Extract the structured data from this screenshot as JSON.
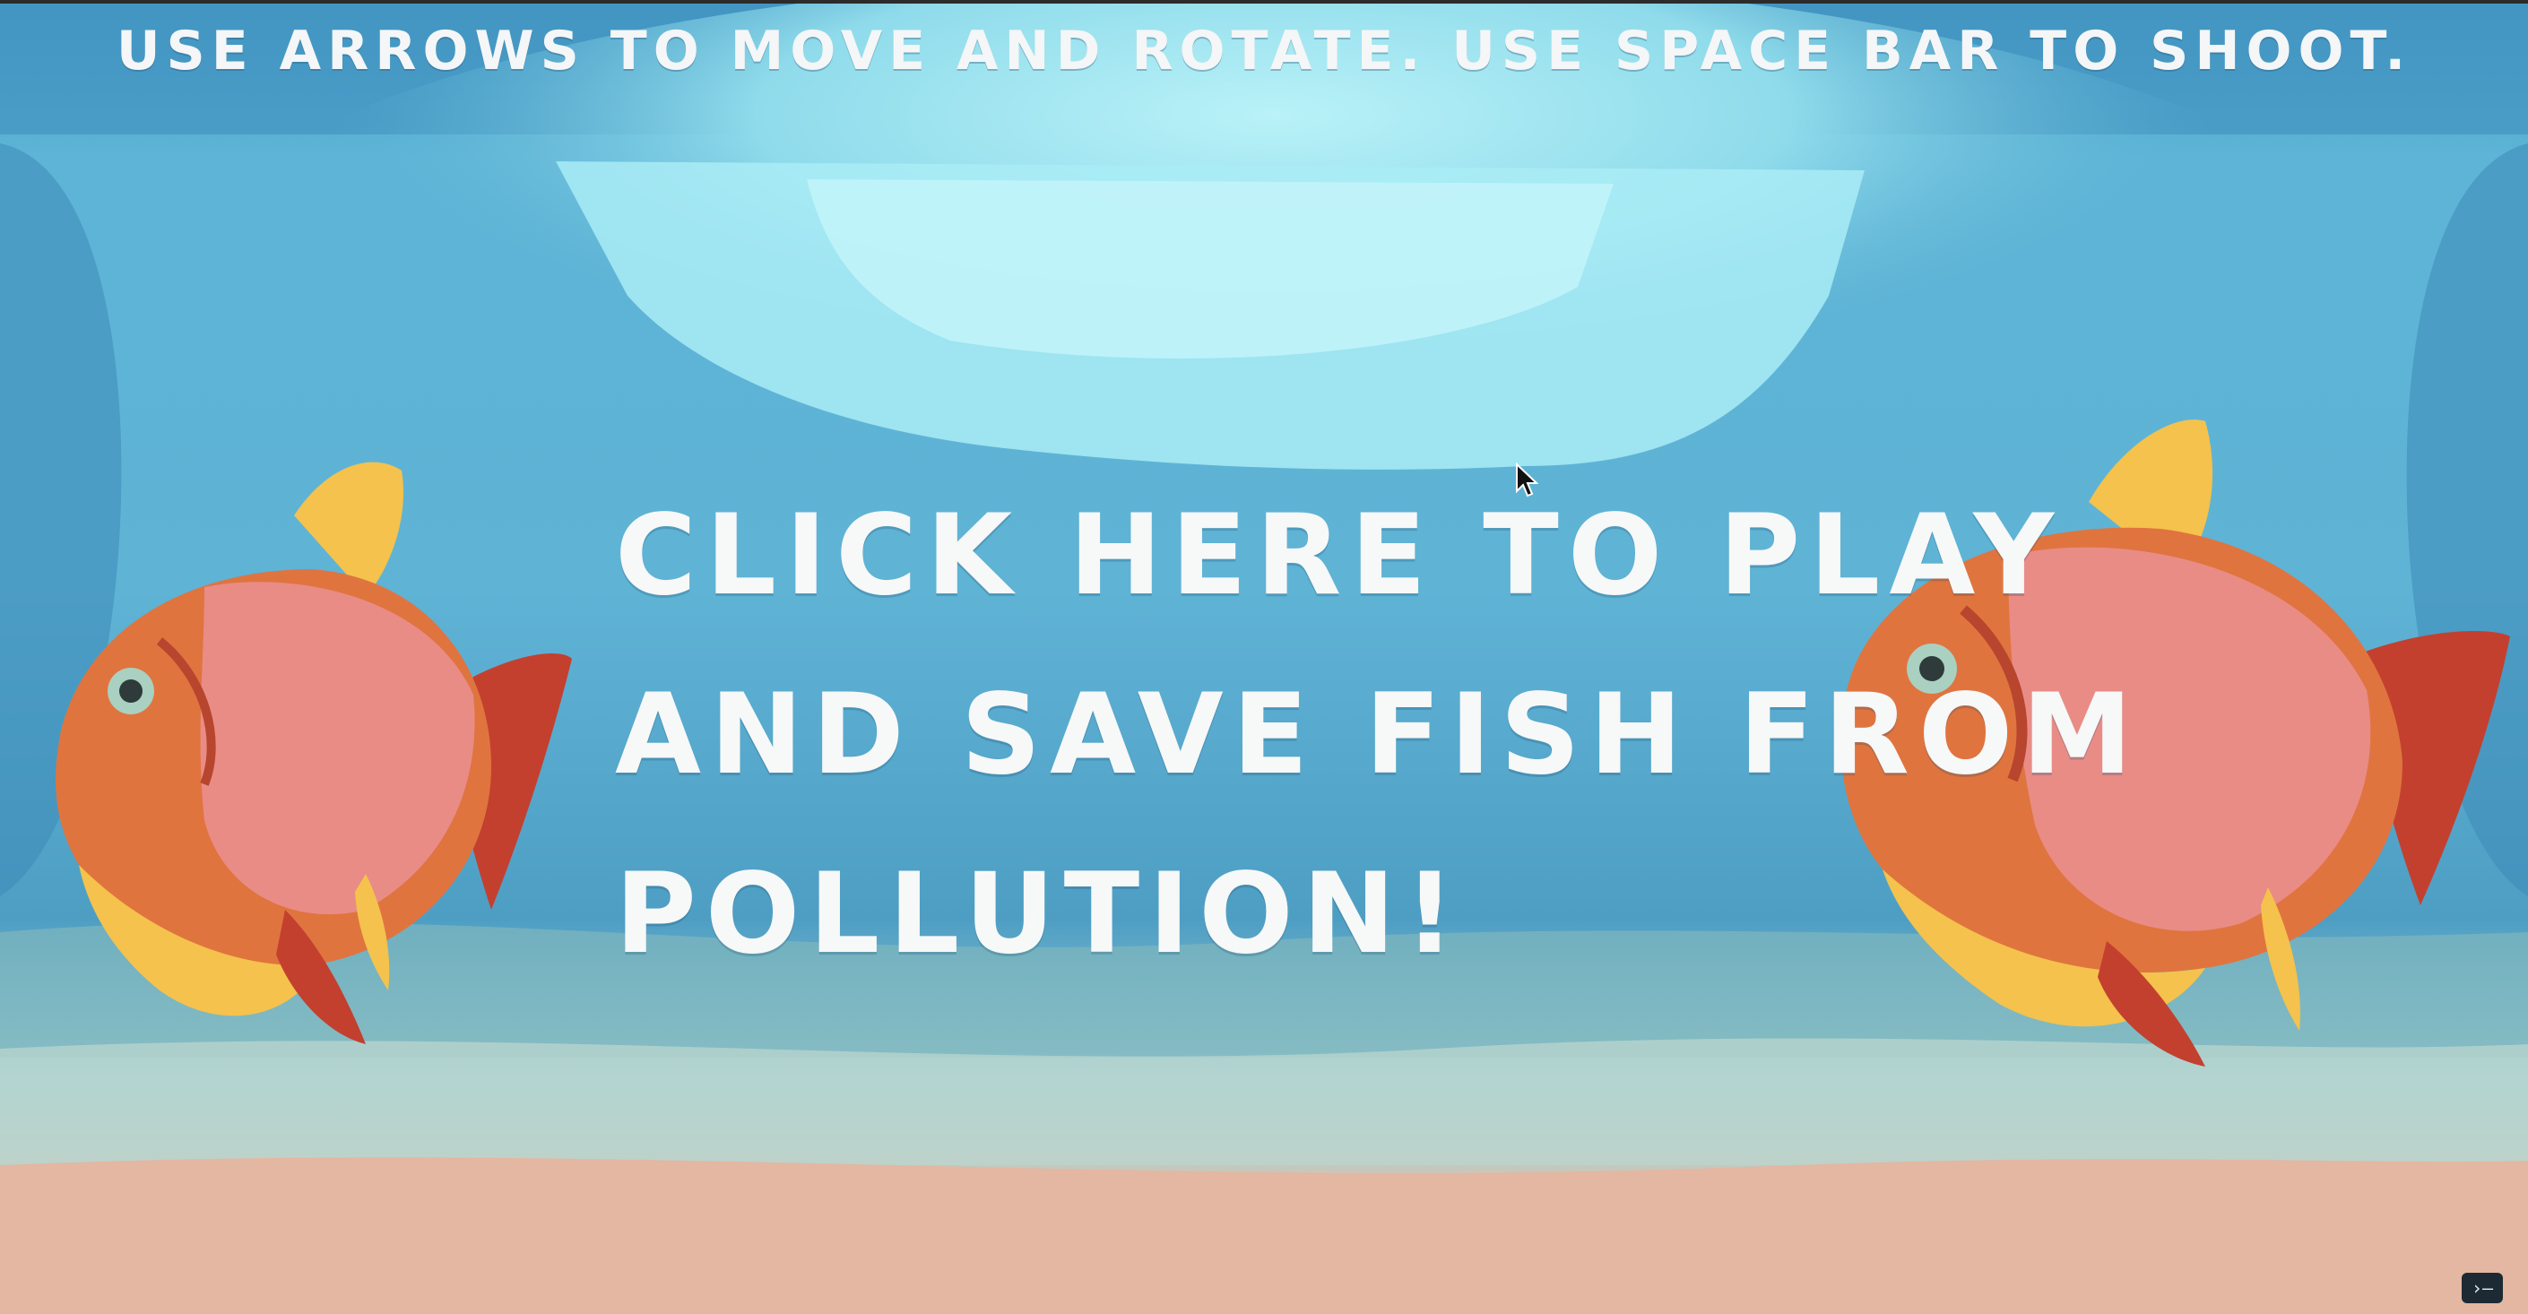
{
  "game": {
    "instructions": "USE ARROWS TO MOVE AND ROTATE. USE SPACE BAR TO SHOOT.",
    "play_lines": [
      "CLICK HERE TO PLAY",
      "AND SAVE FISH FROM",
      "POLLUTION!"
    ]
  },
  "ui": {
    "terminal_button_glyph": "›—"
  },
  "icons": {
    "left_fish": "goldfish-icon",
    "right_fish": "goldfish-icon",
    "cursor": "mouse-pointer-icon",
    "terminal": "terminal-icon"
  },
  "colors": {
    "water_top": "#3f93bf",
    "water_light": "#a8eaf5",
    "water_mid": "#5db4d6",
    "sand": "#e9b9a4",
    "text": "#f4f6f7",
    "fish_orange": "#e0743f",
    "fish_pink": "#ea8f8e",
    "fish_yellow": "#f4c24d",
    "fish_red": "#c3402f"
  }
}
